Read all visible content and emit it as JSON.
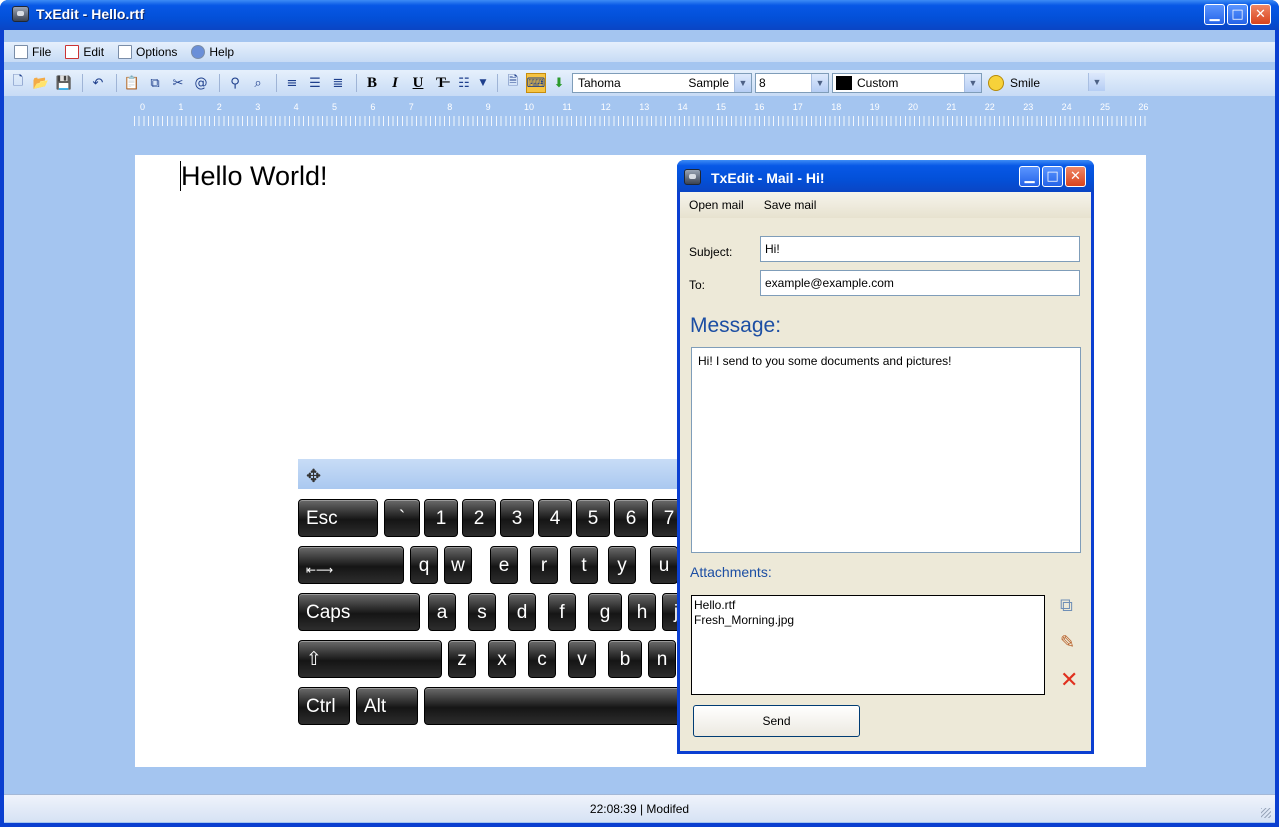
{
  "window": {
    "title": "TxEdit - Hello.rtf",
    "minimize": "▁",
    "maximize": "□",
    "close": "✕"
  },
  "menu": [
    {
      "label": "File",
      "icon": "file-icon"
    },
    {
      "label": "Edit",
      "icon": "edit-icon"
    },
    {
      "label": "Options",
      "icon": "options-icon"
    },
    {
      "label": "Help",
      "icon": "help-icon"
    }
  ],
  "toolbar": {
    "bold": "B",
    "italic": "I",
    "underline": "U",
    "strike": "T̶",
    "font": {
      "name": "Tahoma",
      "sample": "Sample"
    },
    "size": "8",
    "color": {
      "name": "Custom",
      "swatch": "#000000"
    },
    "emoticon": "Smile"
  },
  "ruler": {
    "marks": [
      "0",
      "1",
      "2",
      "3",
      "4",
      "5",
      "6",
      "7",
      "8",
      "9",
      "10",
      "11",
      "12",
      "13",
      "14",
      "15",
      "16",
      "17",
      "18",
      "19",
      "20",
      "21",
      "22",
      "23",
      "24",
      "25",
      "26"
    ]
  },
  "document": {
    "text": "Hello World!"
  },
  "status": {
    "text": "22:08:39 | Modifed"
  },
  "keyboard": {
    "row1": [
      "Esc",
      "`",
      "1",
      "2",
      "3",
      "4",
      "5",
      "6",
      "7"
    ],
    "row2": [
      "q",
      "w",
      "e",
      "r",
      "t",
      "y",
      "u"
    ],
    "caps": "Caps",
    "row3": [
      "a",
      "s",
      "d",
      "f",
      "g",
      "h",
      "j"
    ],
    "row4": [
      "z",
      "x",
      "c",
      "v",
      "b",
      "n"
    ],
    "ctrl": "Ctrl",
    "alt": "Alt",
    "move": "✥",
    "tab": "⇤⟶",
    "shift": "⇧"
  },
  "mail": {
    "title": "TxEdit - Mail - Hi!",
    "menu": [
      "Open mail",
      "Save mail"
    ],
    "subject_label": "Subject:",
    "subject": "Hi!",
    "to_label": "To:",
    "to": "example@example.com",
    "message_label": "Message:",
    "message": "Hi! I send to you some documents and pictures!",
    "attachments_label": "Attachments:",
    "attachments": [
      "Hello.rtf",
      "Fresh_Morning.jpg"
    ],
    "send": "Send"
  }
}
